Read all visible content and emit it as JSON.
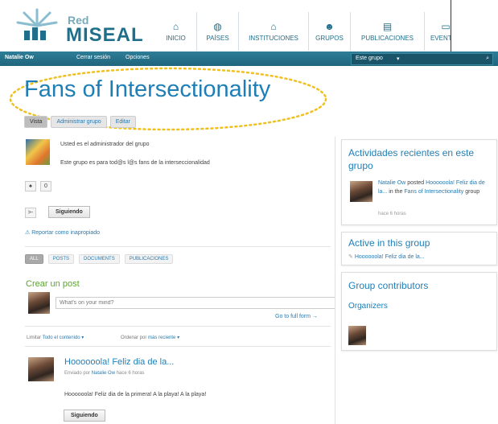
{
  "header": {
    "logo_red": "Red",
    "logo_name": "MISEAL",
    "nav": [
      {
        "label": "INICIO",
        "icon": "home-icon"
      },
      {
        "label": "PAÍSES",
        "icon": "globe-icon"
      },
      {
        "label": "INSTITUCIONES",
        "icon": "institution-icon"
      },
      {
        "label": "GRUPOS",
        "icon": "groups-icon"
      },
      {
        "label": "PUBLICACIONES",
        "icon": "book-icon"
      },
      {
        "label": "EVENTOS",
        "icon": "calendar-icon"
      }
    ]
  },
  "topbar": {
    "user": "Natalie Ow",
    "logout": "Cerrar sesión",
    "options": "Opciones",
    "search_scope": "Este grupo"
  },
  "group": {
    "title": "Fans of Intersectionality",
    "tabs": [
      "Vista",
      "Administrar grupo",
      "Editar"
    ],
    "admin_note": "Usted es el administrador del grupo",
    "description": "Este grupo es para tod@s l@s fans de la interseccionalidad",
    "likes": "0",
    "follow_label": "Siguiendo",
    "report_label": "Reportar como inapropiado"
  },
  "filters": [
    "ALL",
    "POSTS",
    "DOCUMENTS",
    "PUBLICACIONES"
  ],
  "create": {
    "heading": "Crear un post",
    "placeholder": "What's on your mind?",
    "full_form": "Go to full form",
    "limit_label": "Limitar",
    "limit_value": "Todo el contenido",
    "order_label": "Ordenar por",
    "order_value": "más reciente"
  },
  "post": {
    "title": "Hoooooola! Feliz dia de la...",
    "meta_prefix": "Enviado por",
    "author": "Natalie Ow",
    "when": "hace 6 horas",
    "body": "Hoooooola! Feliz dia de la primera! A la playa! A la playa!",
    "follow_label": "Siguiendo"
  },
  "sidebar": {
    "recent_title": "Actividades recientes en este grupo",
    "recent_actor": "Natalie Ow",
    "recent_verb": "posted",
    "recent_post": "Hoooooola! Feliz dia de la...",
    "recent_in": "in the",
    "recent_group": "Fans of Intersectionality",
    "recent_suffix": "group",
    "recent_time": "hace 6 horas",
    "active_title": "Active in this group",
    "active_item": "Hoooooola! Feliz dia de la...",
    "contributors_title": "Group contributors",
    "organizers_label": "Organizers"
  },
  "colors": {
    "accent": "#1e7fb7",
    "topbar": "#2e7d97",
    "create": "#5aa52e"
  }
}
